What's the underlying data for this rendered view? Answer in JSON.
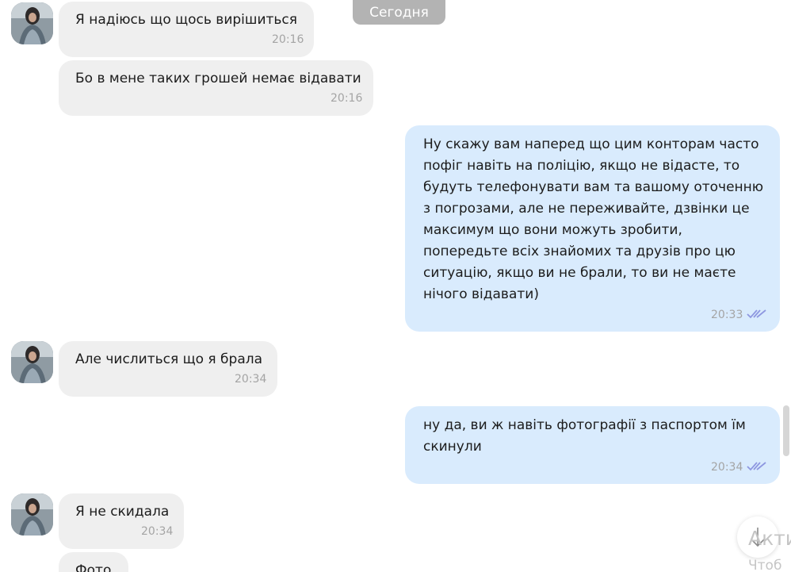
{
  "date_divider": "Сегодня",
  "messages": [
    {
      "lines": [
        "Я надіюсь що щось вирішиться"
      ],
      "time": "20:16"
    },
    {
      "lines": [
        "Бо в мене таких грошей немає відавати"
      ],
      "time": "20:16"
    },
    {
      "lines": [
        "Ну скажу вам наперед що цим конторам часто",
        "пофіг навіть на поліцію, якщо не відасте, то",
        "будуть телефонувати вам та вашому оточенню",
        "з погрозами, але не переживайте, дзвінки це",
        "максимум що вони можуть зробити,",
        "попередьте всіх знайомих та друзів про цю",
        "ситуацію, якщо ви не брали, то ви не маєте",
        "нічого відавати)"
      ],
      "time": "20:33"
    },
    {
      "lines": [
        "Але числиться що я брала"
      ],
      "time": "20:34"
    },
    {
      "lines": [
        "ну да, ви ж навіть фотографії з паспортом їм",
        "скинули"
      ],
      "time": "20:34"
    },
    {
      "lines": [
        "Я не скидала"
      ],
      "time": "20:34"
    },
    {
      "lines": [
        "Фото"
      ],
      "time": ""
    }
  ],
  "watermark": {
    "line1": "Акти",
    "line2": "Чтоб"
  },
  "colors": {
    "incoming_bubble": "#efefef",
    "outgoing_bubble": "#d9ebfd",
    "date_pill": "#b3b3b3",
    "ticks": "#8e97e0",
    "time": "#a4a4a4"
  },
  "icons": {
    "avatar": "contact-avatar-photo",
    "read": "double-check-icon",
    "scroll": "arrow-down-icon"
  }
}
